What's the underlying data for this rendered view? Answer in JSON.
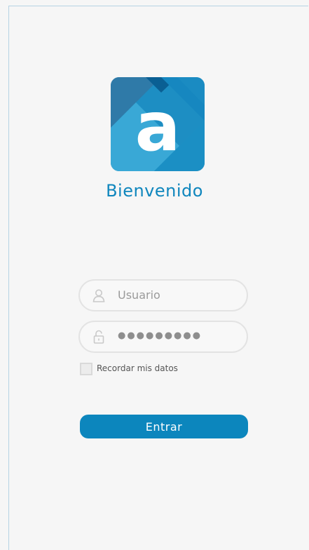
{
  "brand": {
    "logo_letter": "a",
    "welcome_text": "Bienvenido",
    "colors": {
      "primary": "#0c86bd",
      "logo_dark": "#2f7aa8",
      "logo_mid": "#1d8ec3",
      "logo_light": "#39a8d6",
      "logo_deep": "#0a5f93"
    }
  },
  "form": {
    "username": {
      "icon": "user-icon",
      "placeholder": "Usuario"
    },
    "password": {
      "icon": "lock-icon",
      "masked_value": "●●●●●●●●●"
    },
    "remember": {
      "label": "Recordar mis datos",
      "checked": false
    },
    "submit_label": "Entrar"
  }
}
